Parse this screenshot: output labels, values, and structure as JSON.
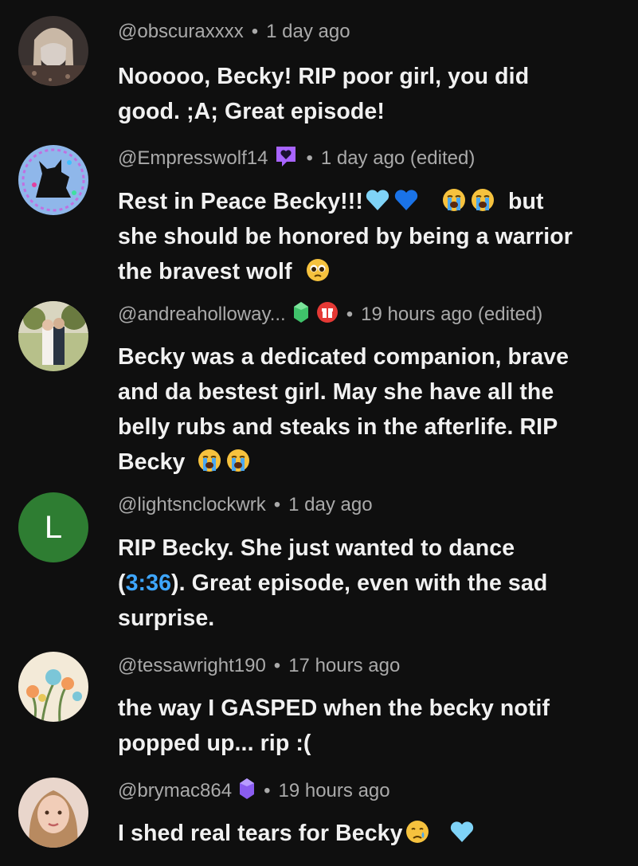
{
  "comments": [
    {
      "handle": "@obscuraxxxx",
      "time": "1 day ago",
      "lines": [
        "Nooooo, Becky! RIP poor girl, you did",
        "good. ;A; Great episode!"
      ]
    },
    {
      "handle": "@Empresswolf14",
      "time": "1 day ago (edited)",
      "line1": "Rest in Peace Becky!!!",
      "line1b": "but",
      "line2": "she should be honored by being a warrior",
      "line3": "the bravest wolf"
    },
    {
      "handle": "@andreaholloway...",
      "time": "19 hours ago (edited)",
      "lines": [
        "Becky was a dedicated companion, brave",
        "and da bestest girl. May she have all the",
        "belly rubs and steaks in the afterlife. RIP"
      ],
      "line4": "Becky"
    },
    {
      "handle": "@lightsnclockwrk",
      "time": "1 day ago",
      "avatar_letter": "L",
      "line1": "RIP Becky. She just wanted to dance",
      "line2_pre": "(",
      "timestamp": "3:36",
      "line2_post": "). Great episode, even with the sad",
      "line3": "surprise."
    },
    {
      "handle": "@tessawright190",
      "time": "17 hours ago",
      "lines": [
        "the way I GASPED when the becky notif",
        "popped up... rip :("
      ]
    },
    {
      "handle": "@brymac864",
      "time": "19 hours ago",
      "line1": "I shed real tears for Becky"
    }
  ],
  "colors": {
    "background": "#0f0f0f",
    "meta": "#aaaaaa",
    "text": "#f1f1f1",
    "timestamp_link": "#3ea6ff",
    "avatar_L": "#2e7d32",
    "member_badge": "#a864ff"
  }
}
